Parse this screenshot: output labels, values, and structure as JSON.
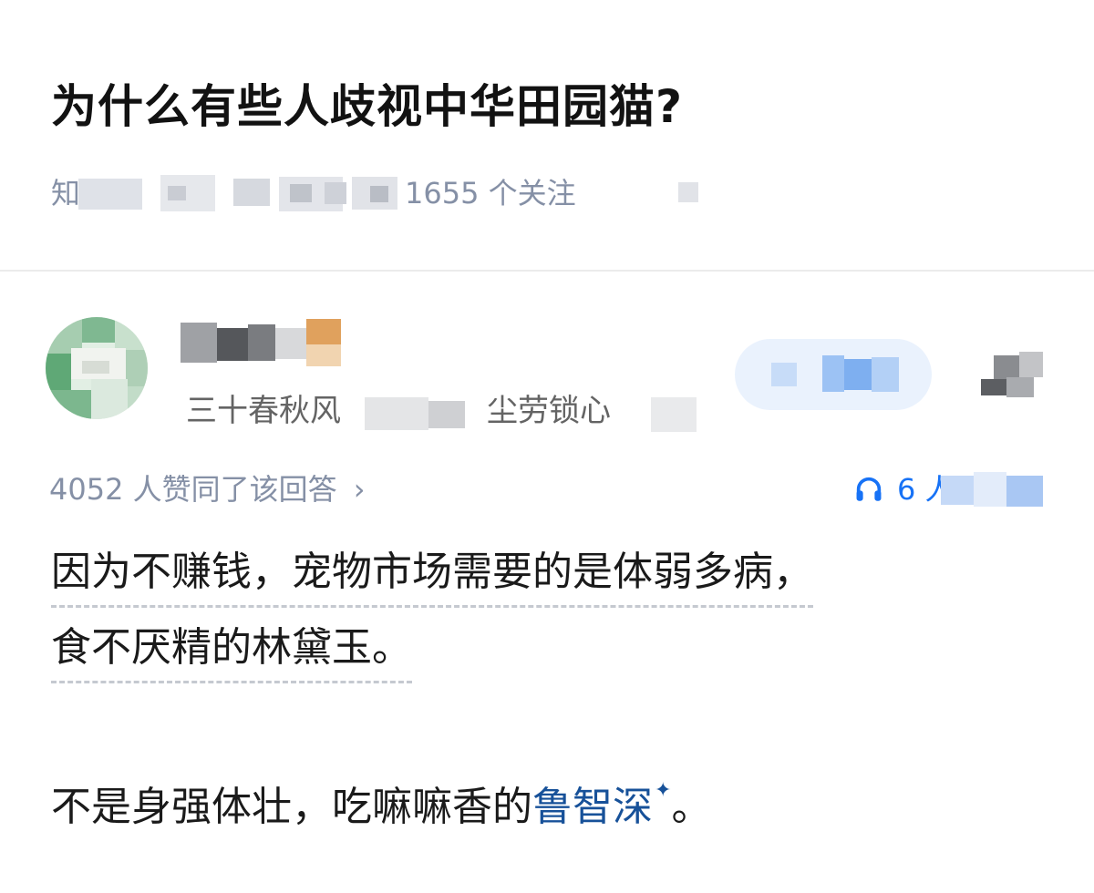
{
  "question": {
    "title": "为什么有些人歧视中华田园猫?",
    "meta_visible_fragments": {
      "prefix": "知",
      "followers": "1655 个关注"
    }
  },
  "answer": {
    "author": {
      "bio_visible_prefix": "三十春秋风",
      "bio_visible_mid": "尘劳锁心"
    },
    "agree_text": "4052 人赞同了该回答",
    "agree_chevron": "›",
    "listen": {
      "icon": "headphones-icon",
      "text_visible": "6 人听"
    },
    "paragraphs": [
      {
        "lines": [
          "因为不赚钱，宠物市场需要的是体弱多病，",
          "食不厌精的林黛玉。"
        ]
      },
      {
        "before_link": "不是身强体壮，吃嘛嘛香的",
        "link_text": "鲁智深",
        "spark": "✦",
        "after_link": "。"
      }
    ]
  },
  "colors": {
    "title": "#121212",
    "meta": "#8590a6",
    "link": "#175199",
    "accent_blue": "#1772f6",
    "divider": "#ebebeb"
  }
}
